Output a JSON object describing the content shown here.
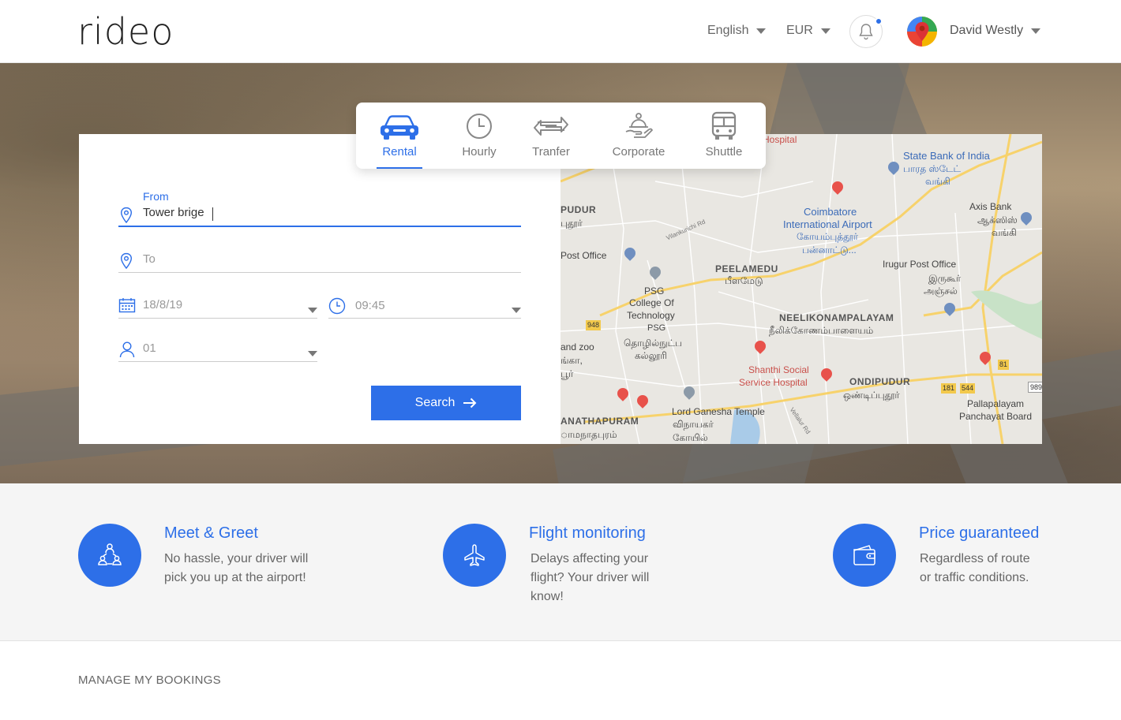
{
  "header": {
    "logo": "rideo",
    "language": "English",
    "currency": "EUR",
    "user_name": "David Westly"
  },
  "tabs": [
    {
      "label": "Rental",
      "icon": "car-icon",
      "active": true
    },
    {
      "label": "Hourly",
      "icon": "clock-icon",
      "active": false
    },
    {
      "label": "Tranfer",
      "icon": "transfer-arrows-icon",
      "active": false
    },
    {
      "label": "Corporate",
      "icon": "hand-service-icon",
      "active": false
    },
    {
      "label": "Shuttle",
      "icon": "bus-icon",
      "active": false
    }
  ],
  "form": {
    "from_label": "From",
    "from_value": "Tower brige",
    "to_placeholder": "To",
    "date": "18/8/19",
    "time": "09:45",
    "passengers": "01",
    "search_label": "Search"
  },
  "map": {
    "labels": [
      "Hospital",
      "State Bank of India",
      "பாரத ஸ்டேட்",
      "வங்கி",
      "PUDUR",
      "புதூர்",
      "Axis Bank",
      "ஆக்ஸிஸ்",
      "வங்கி",
      "Coimbatore",
      "International Airport",
      "கோயம்புத்தூர்",
      "பன்னாட்டு...",
      "Post Office",
      "PEELAMEDU",
      "பீளமேடு",
      "Irugur Post Office",
      "இருகூர்",
      "அஞ்சல்",
      "PSG",
      "College Of",
      "Technology",
      "PSG",
      "தொழில்நுட்ப",
      "கல்லூரி",
      "NEELIKONAMPALAYAM",
      "நீலிக்கோணம்பாளையம்",
      "and zoo",
      "ங்கா,",
      "பூர்",
      "Shanthi Social",
      "Service Hospital",
      "ONDIPUDUR",
      "ஒண்டிப்புதூர்",
      "Pallapalayam",
      "Panchayat Board",
      "Lord Ganesha Temple",
      "விநாயகர்",
      "கோயில்",
      "ANATHAPURAM",
      "ாமநாதபுரம்",
      "Vilankurichi Rd",
      "Vellalur Rd",
      "948",
      "181",
      "544",
      "81",
      "989"
    ]
  },
  "features": [
    {
      "title": "Meet & Greet",
      "lines": [
        "No hassle, your driver will",
        "pick you up at the airport!"
      ],
      "icon": "meet-greet-icon"
    },
    {
      "title": "Flight monitoring",
      "lines": [
        "Delays affecting your",
        "flight? Your driver will",
        "know!"
      ],
      "icon": "airplane-icon"
    },
    {
      "title": "Price guaranteed",
      "lines": [
        "Regardless of route",
        "or traffic conditions."
      ],
      "icon": "wallet-icon"
    }
  ],
  "manage_bookings": "MANAGE MY BOOKINGS",
  "colors": {
    "accent": "#2d6fe8"
  }
}
